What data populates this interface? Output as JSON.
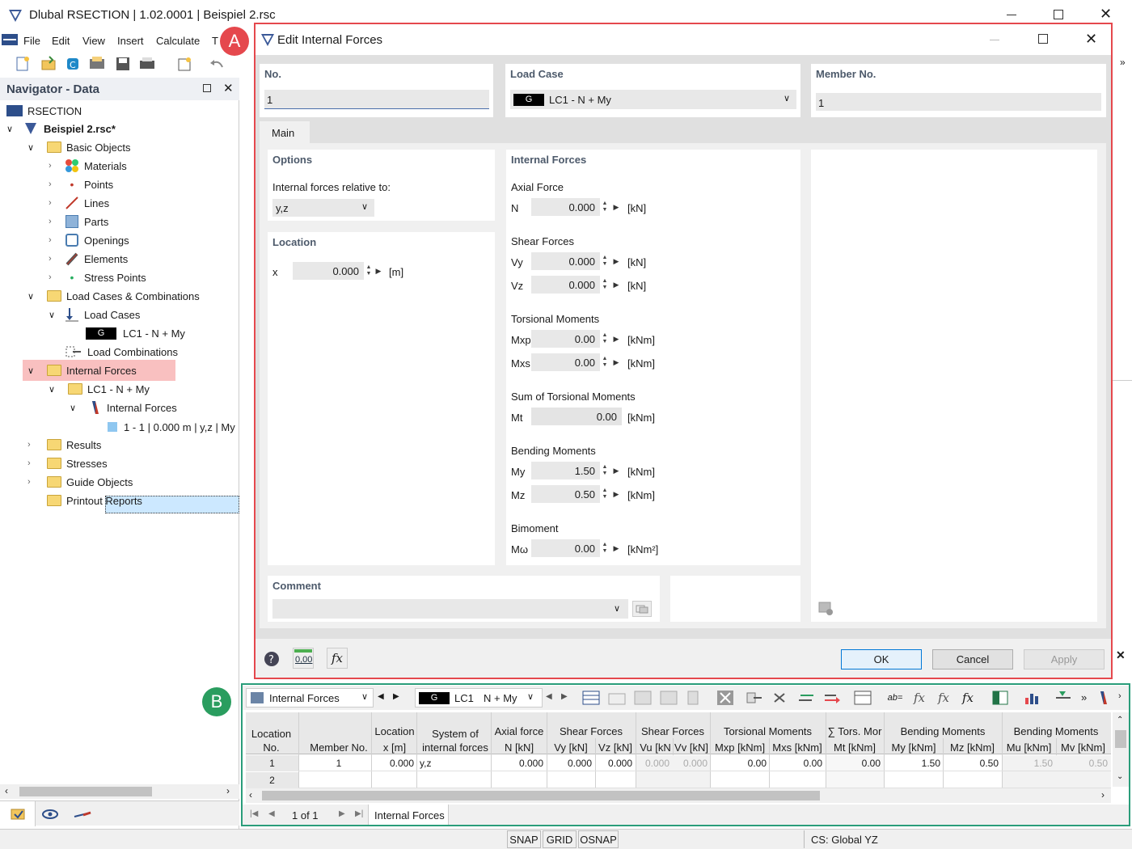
{
  "app": {
    "title": "Dlubal RSECTION | 1.02.0001 | Beispiel 2.rsc"
  },
  "menu": [
    "File",
    "Edit",
    "View",
    "Insert",
    "Calculate",
    "T"
  ],
  "navigator": {
    "title": "Navigator - Data",
    "root": "RSECTION",
    "file": "Beispiel 2.rsc*",
    "items": {
      "basic_objects": "Basic Objects",
      "materials": "Materials",
      "points": "Points",
      "lines": "Lines",
      "parts": "Parts",
      "openings": "Openings",
      "elements": "Elements",
      "stress_points": "Stress Points",
      "load_cases_comb": "Load Cases & Combinations",
      "load_cases": "Load Cases",
      "lc_badge": "G",
      "lc1": "LC1 - N + My",
      "load_combinations": "Load Combinations",
      "internal_forces": "Internal Forces",
      "lc1_folder": "LC1 - N + My",
      "internal_forces_sub": "Internal Forces",
      "if_item": "1 - 1 | 0.000 m | y,z | My",
      "results": "Results",
      "stresses": "Stresses",
      "guide_objects": "Guide Objects",
      "printout_reports": "Printout Reports"
    }
  },
  "callouts": {
    "a": "A",
    "b": "B"
  },
  "dialog": {
    "title": "Edit Internal Forces",
    "no_label": "No.",
    "no_value": "1",
    "load_case_label": "Load Case",
    "load_case_badge": "G",
    "load_case_value": "LC1 - N + My",
    "member_label": "Member No.",
    "member_value": "1",
    "tab": "Main",
    "options_title": "Options",
    "relative_label": "Internal forces relative to:",
    "relative_value": "y,z",
    "location_title": "Location",
    "x_label": "x",
    "x_value": "0.000",
    "x_unit": "[m]",
    "if_title": "Internal Forces",
    "axial_title": "Axial Force",
    "n_label": "N",
    "n_value": "0.000",
    "n_unit": "[kN]",
    "shear_title": "Shear Forces",
    "vy_label": "Vy",
    "vy_value": "0.000",
    "vy_unit": "[kN]",
    "vz_label": "Vz",
    "vz_value": "0.000",
    "vz_unit": "[kN]",
    "torsion_title": "Torsional Moments",
    "mxp_label": "Mxp",
    "mxp_value": "0.00",
    "mxp_unit": "[kNm]",
    "mxs_label": "Mxs",
    "mxs_value": "0.00",
    "mxs_unit": "[kNm]",
    "sum_torsion_title": "Sum of Torsional Moments",
    "mt_label": "Mt",
    "mt_value": "0.00",
    "mt_unit": "[kNm]",
    "bending_title": "Bending Moments",
    "my_label": "My",
    "my_value": "1.50",
    "my_unit": "[kNm]",
    "mz_label": "Mz",
    "mz_value": "0.50",
    "mz_unit": "[kNm]",
    "bimoment_title": "Bimoment",
    "mw_label": "Mω",
    "mw_value": "0.00",
    "mw_unit": "[kNm²]",
    "comment_title": "Comment",
    "ok": "OK",
    "cancel": "Cancel",
    "apply": "Apply",
    "num_icon_label": "0,00"
  },
  "table": {
    "selector": "Internal Forces",
    "lc_badge": "G",
    "lc_name": "LC1",
    "lc_desc": "N + My",
    "headers": [
      {
        "top": "",
        "bottom": "Location No."
      },
      {
        "top": "",
        "bottom": "Member No."
      },
      {
        "top": "Location",
        "bottom": "x [m]"
      },
      {
        "top": "System of",
        "bottom": "internal forces"
      },
      {
        "top": "Axial force",
        "bottom": "N [kN]"
      },
      {
        "top": "Shear Forces",
        "bottom": "Vy [kN]"
      },
      {
        "top": "",
        "bottom": "Vz [kN]"
      },
      {
        "top": "Shear Forces",
        "bottom": "Vu [kN"
      },
      {
        "top": "",
        "bottom": "Vv [kN]"
      },
      {
        "top": "Torsional Moments",
        "bottom": "Mxp [kNm]"
      },
      {
        "top": "",
        "bottom": "Mxs [kNm]"
      },
      {
        "top": "∑ Tors. Mor",
        "bottom": "Mt [kNm]"
      },
      {
        "top": "Bending Moments",
        "bottom": "My [kNm]"
      },
      {
        "top": "",
        "bottom": "Mz [kNm]"
      },
      {
        "top": "Bending Moments",
        "bottom": "Mu [kNm]"
      },
      {
        "top": "",
        "bottom": "Mv [kNm]"
      }
    ],
    "rows": [
      [
        "1",
        "1",
        "0.000",
        "y,z",
        "0.000",
        "0.000",
        "0.000",
        "0.000",
        "0.000",
        "0.00",
        "0.00",
        "0.00",
        "1.50",
        "0.50",
        "1.50",
        "0.50"
      ],
      [
        "2",
        "",
        "",
        "",
        "",
        "",
        "",
        "",
        "",
        "",
        "",
        "",
        "",
        "",
        "",
        ""
      ]
    ],
    "pager": "1 of 1",
    "sheet_tab": "Internal Forces"
  },
  "status": {
    "snap": "SNAP",
    "grid": "GRID",
    "osnap": "OSNAP",
    "cs": "CS: Global YZ"
  },
  "colors": {
    "red_frame": "#e5484d",
    "green_frame": "#2a9d7a",
    "callout_red": "#e5484d",
    "callout_green": "#2a9d5f",
    "highlight": "#f9c0c0",
    "selected": "#cce8ff"
  }
}
